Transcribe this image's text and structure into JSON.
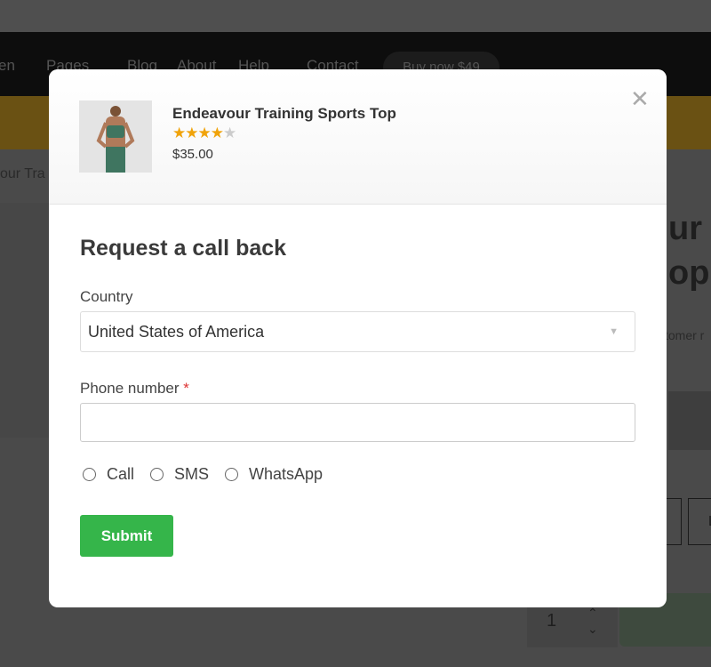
{
  "background": {
    "nav": [
      "en",
      "Pages",
      "Blog",
      "About",
      "Help",
      "Contact"
    ],
    "buy_now": "Buy now $49",
    "breadcrumb": "our Tra",
    "heading_line1": "ur",
    "heading_line2": "op",
    "customer_text": "tomer r",
    "size_label": "L",
    "quantity": "1"
  },
  "modal": {
    "product": {
      "title": "Endeavour Training Sports Top",
      "rating": 4,
      "rating_max": 5,
      "price": "$35.00"
    },
    "close_icon": "close-icon",
    "title": "Request a call back",
    "country_label": "Country",
    "country_value": "United States of America",
    "phone_label": "Phone number",
    "required_mark": "*",
    "phone_value": "",
    "contact_methods": [
      "Call",
      "SMS",
      "WhatsApp"
    ],
    "submit_label": "Submit"
  },
  "colors": {
    "accent": "#35b54a",
    "star": "#f0a30a",
    "required": "#dd3333"
  }
}
